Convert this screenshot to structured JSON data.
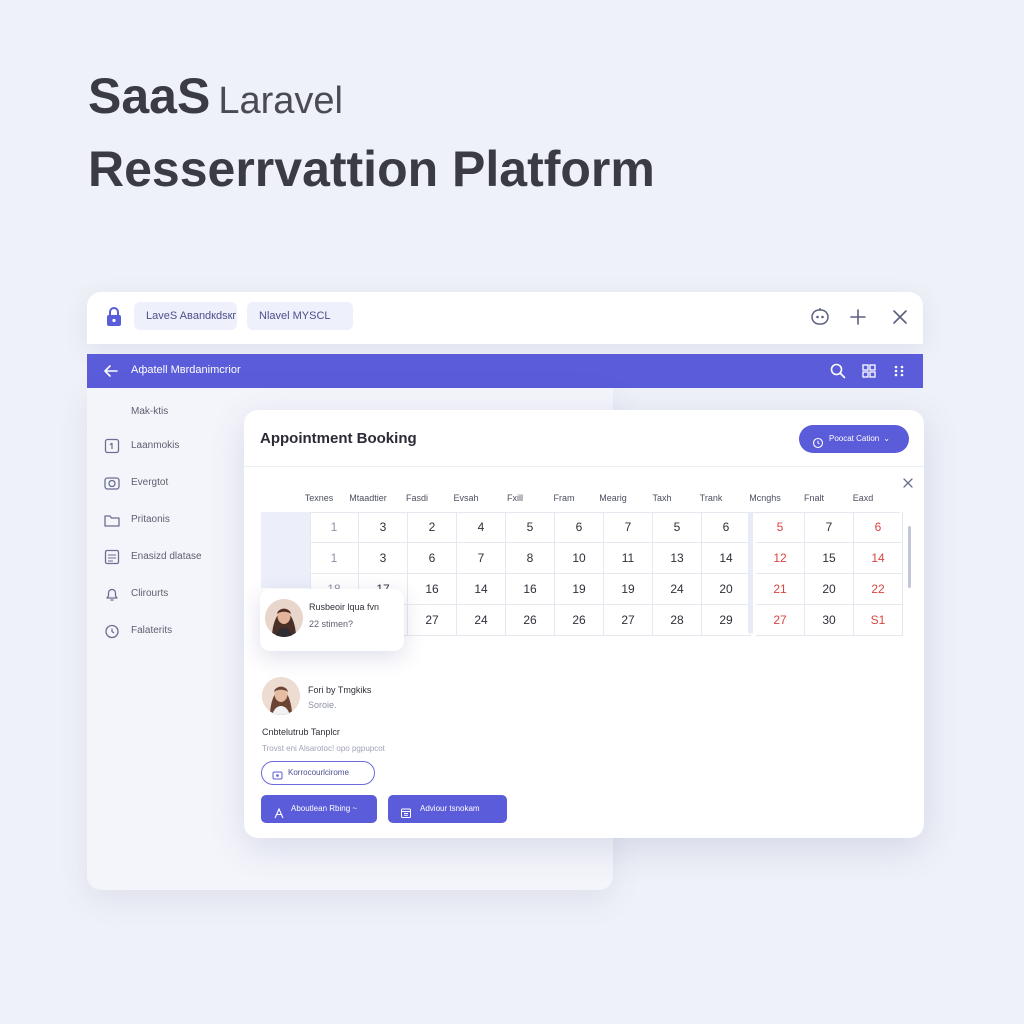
{
  "hero": {
    "title_bold": "SaaS",
    "title_light": "Laravel",
    "title_line2": "Resserrvattion Platform"
  },
  "window": {
    "tabs": [
      {
        "label": "LaveS Aвandкdsкг"
      },
      {
        "label": "Nlavel MYSCL"
      }
    ],
    "icons": [
      "lock-icon",
      "bot-icon",
      "plus-icon",
      "close-icon"
    ]
  },
  "navbar": {
    "title": "Aфatell Mвrdanimcrior",
    "icons": [
      "back-arrow-icon",
      "search-icon",
      "grid-icon",
      "dots-icon"
    ],
    "color": "#5b5cda"
  },
  "sidebar": {
    "heading": "Mak-ktis",
    "items": [
      {
        "label": "Laanmokis",
        "icon": "document-icon"
      },
      {
        "label": "Evergtot",
        "icon": "camera-icon"
      },
      {
        "label": "Pritaonis",
        "icon": "folder-icon"
      },
      {
        "label": "Enasizd dlatase",
        "icon": "list-icon"
      },
      {
        "label": "Clirourts",
        "icon": "bell-icon"
      },
      {
        "label": "Falaterits",
        "icon": "clock-icon"
      }
    ]
  },
  "card": {
    "title": "Appointment Booking",
    "pill_button": "Poocat Cation",
    "headers": [
      "Texnes",
      "Mtaadtier",
      "Fasdi",
      "Evsah",
      "Fxill",
      "Fram",
      "Mearig",
      "Taxh",
      "Trank",
      "Mcnghs",
      "Fnalt",
      "Eaxd"
    ],
    "weeks": [
      [
        "1",
        "3",
        "2",
        "4",
        "5",
        "6",
        "7",
        "5",
        "6",
        "5",
        "7",
        "6"
      ],
      [
        "1",
        "3",
        "6",
        "7",
        "8",
        "10",
        "11",
        "13",
        "14",
        "12",
        "15",
        "14"
      ],
      [
        "18",
        "17",
        "16",
        "14",
        "16",
        "19",
        "19",
        "24",
        "20",
        "21",
        "20",
        "22"
      ],
      [
        "",
        "",
        "27",
        "24",
        "26",
        "26",
        "27",
        "28",
        "29",
        "27",
        "30",
        "S1"
      ]
    ],
    "red_color": "#d9453f",
    "accent": "#5b5cda"
  },
  "popup": {
    "name": "Rusbeoir lqua fvn",
    "sub": "22 stimen?"
  },
  "profile": {
    "name": "Fori by Tmgkiks",
    "sub": "Soroie."
  },
  "details": {
    "title": "Cnbtelutrub Tanplcr",
    "sub": "Trovst eni Alsarotoc! opo pgpupcot",
    "outline_button": "Korrocourlcirome",
    "button_a": "Aboutlean Rbing ~",
    "button_b": "Adviour tsnokam"
  }
}
